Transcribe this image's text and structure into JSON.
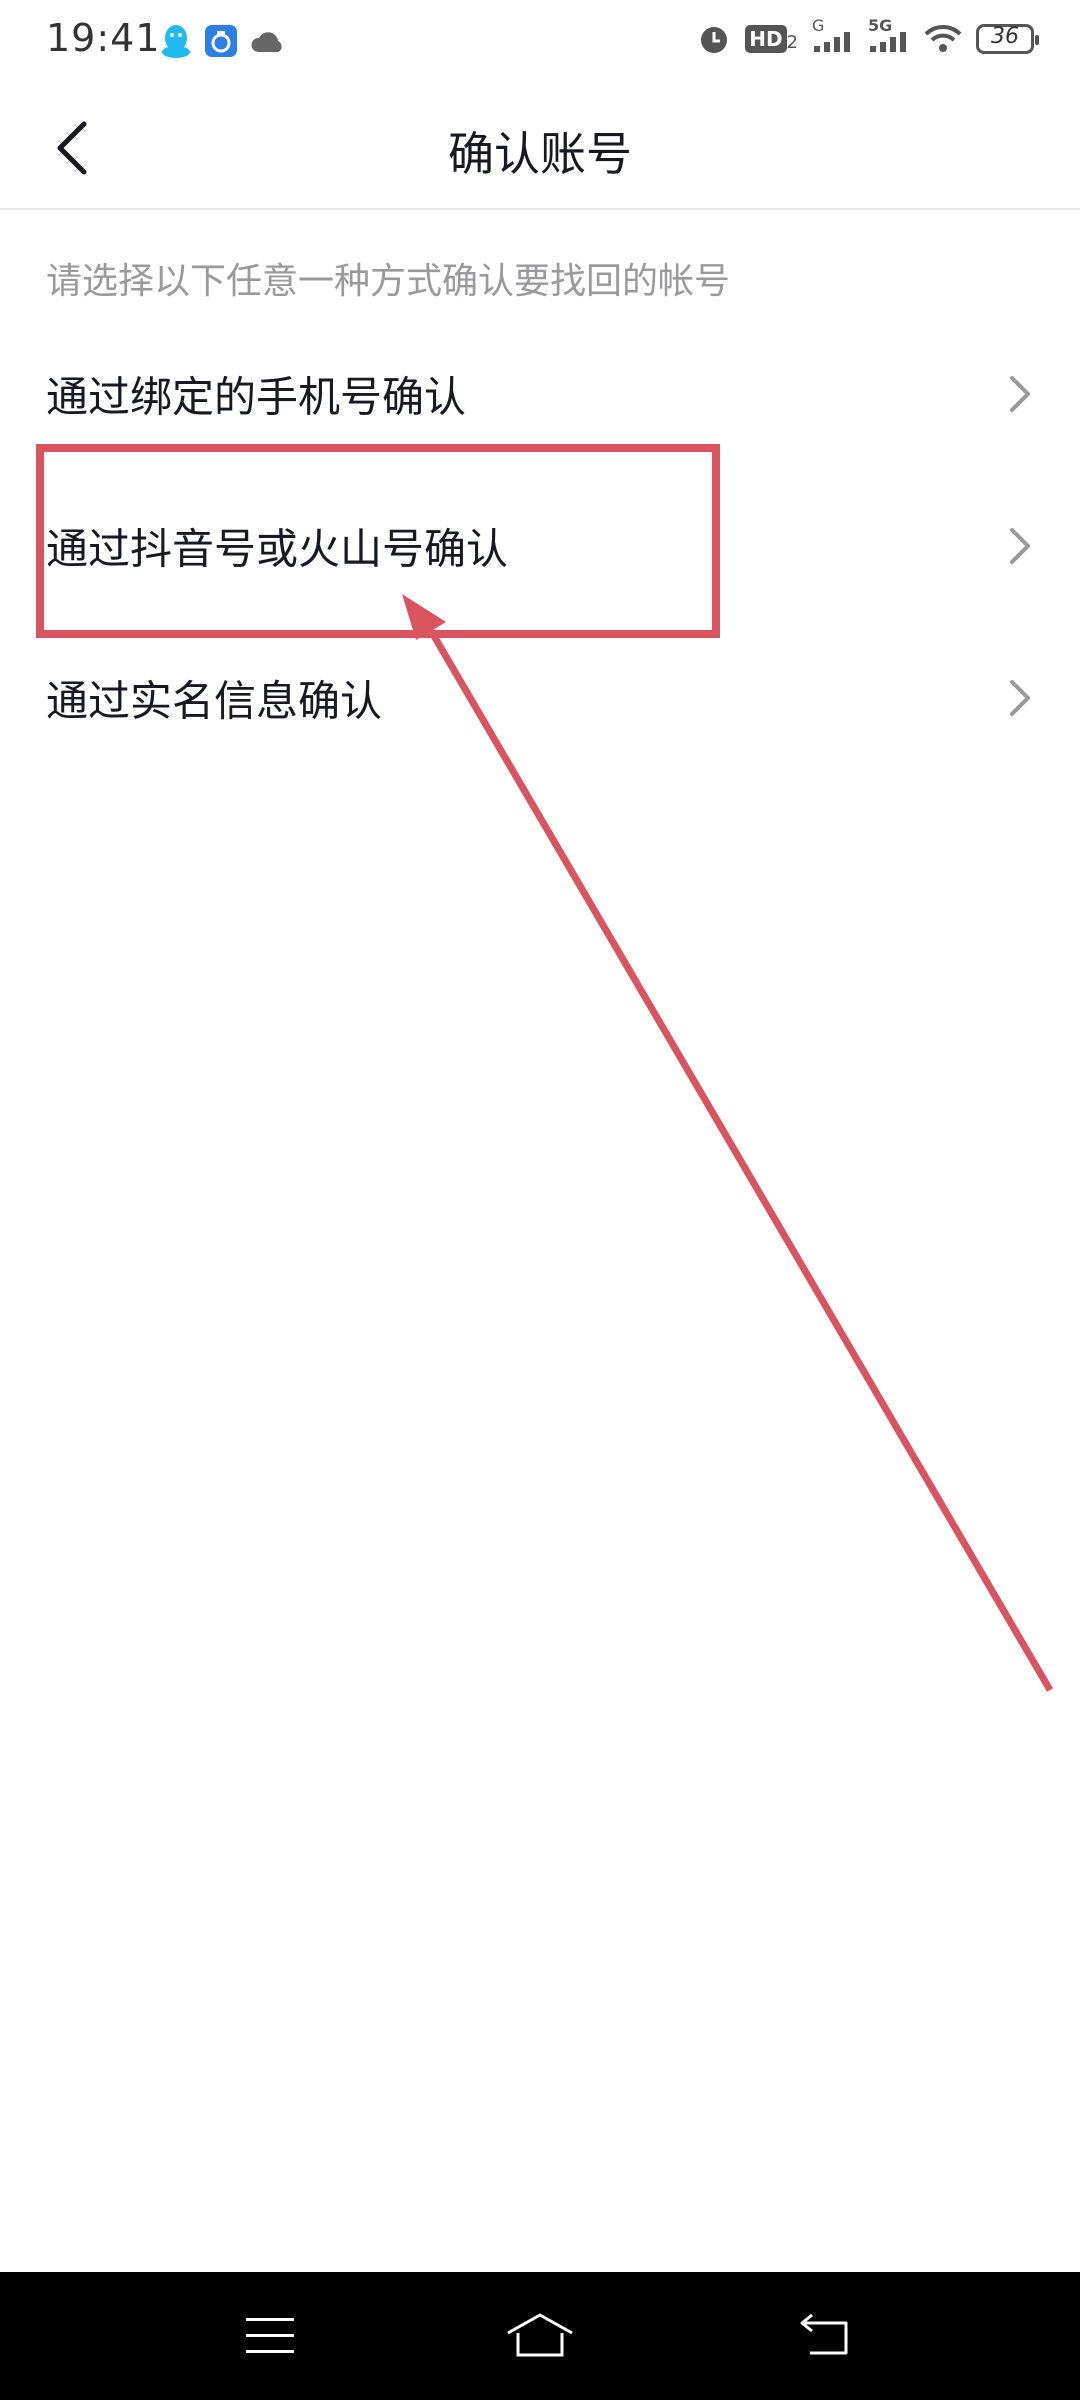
{
  "status_bar": {
    "time": "19:41",
    "left_icons": [
      "qq-icon",
      "app-notification-icon",
      "cloud-icon"
    ],
    "right_icons": [
      "alarm-icon",
      "hd-icon",
      "signal-icon",
      "5g-signal-icon",
      "wifi-icon",
      "battery-icon"
    ],
    "hd_label": "HD",
    "hd_sub": "2",
    "g_label": "G",
    "fiveg_label": "5G",
    "battery_level": "36"
  },
  "nav": {
    "title": "确认账号",
    "back_icon": "chevron-left-icon"
  },
  "hint": "请选择以下任意一种方式确认要找回的帐号",
  "options": [
    {
      "label": "通过绑定的手机号确认"
    },
    {
      "label": "通过抖音号或火山号确认"
    },
    {
      "label": "通过实名信息确认"
    }
  ],
  "colors": {
    "annotation": "#d9545f",
    "text_primary": "#161823",
    "text_secondary": "#9a9a9e",
    "chevron": "#9a9a9e",
    "qq_blue": "#1ebaf0",
    "app_blue": "#2b7fe6"
  },
  "system_nav": [
    "menu-icon",
    "home-icon",
    "back-icon"
  ]
}
